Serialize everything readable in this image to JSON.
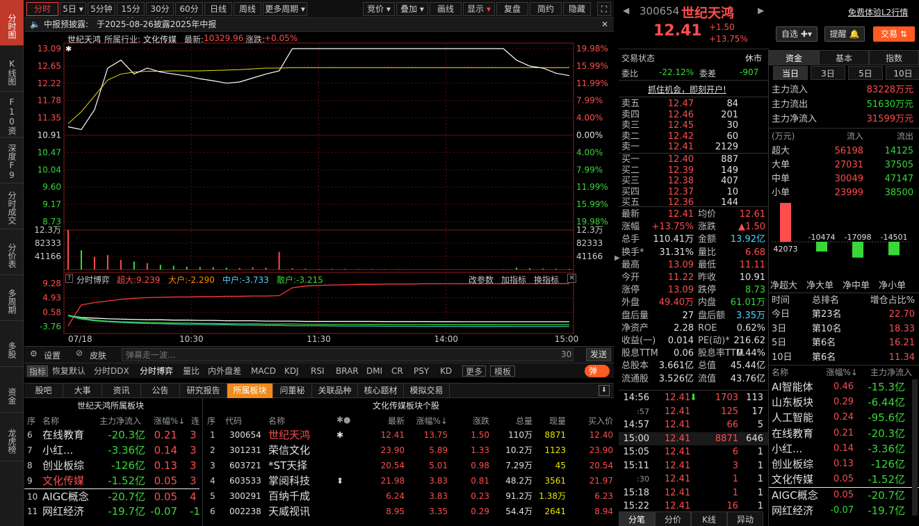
{
  "sidebar": [
    {
      "label": "分时图",
      "active": true
    },
    {
      "label": "K线图"
    },
    {
      "label": "F10资料"
    },
    {
      "label": "深度F9"
    },
    {
      "label": "分时成交"
    },
    {
      "label": "分价表"
    },
    {
      "label": "多周期"
    },
    {
      "label": "多股"
    },
    {
      "label": "资金"
    },
    {
      "label": "龙虎榜"
    }
  ],
  "toolbar": {
    "periods": [
      "分时",
      "5日",
      "5分钟",
      "15分钟",
      "30分钟",
      "60分钟",
      "日线",
      "周线",
      "更多周期"
    ],
    "tools": [
      "竞价",
      "叠加",
      "画线",
      "显示",
      "复盘",
      "简约",
      "隐藏"
    ]
  },
  "notice": {
    "label": "中报预披露:",
    "text": "于2025-08-26披露2025年中报"
  },
  "chart_header": {
    "name": "世纪天鸿",
    "industry_label": "所属行业:",
    "industry": "文化传媒",
    "latest_label": "最新:",
    "latest": "10329.96",
    "change_label": "涨跌:",
    "change": "+0.05%"
  },
  "chart_data": {
    "type": "line",
    "price_axis": [
      "13.09",
      "12.65",
      "12.22",
      "11.78",
      "11.35",
      "10.91",
      "10.47",
      "10.04",
      "9.60",
      "9.17",
      "8.73"
    ],
    "pct_axis": [
      "19.98%",
      "15.99%",
      "11.99%",
      "7.99%",
      "4.00%",
      "0.00%",
      "4.00%",
      "7.99%",
      "11.99%",
      "15.99%",
      "19.98%"
    ],
    "prev_close": 10.91,
    "vol_axis": [
      "12.3万",
      "82333",
      "41166"
    ],
    "vol_axis_right": [
      "12.3万",
      "82333",
      "41166"
    ],
    "time_axis": [
      "07/18",
      "10:30",
      "11:30",
      "14:00",
      "15:00"
    ],
    "price": [
      11.12,
      11.05,
      11.55,
      12.6,
      12.8,
      12.45,
      12.6,
      12.5,
      12.45,
      12.4,
      12.33,
      12.28,
      12.22,
      12.25,
      12.35,
      12.45,
      12.53,
      13.09,
      13.09,
      13.09,
      13.09,
      13.09,
      13.09,
      13.09,
      13.09,
      13.09,
      13.09,
      13.09,
      13.09,
      13.09,
      13.09,
      13.09,
      13.09,
      13.09,
      12.8,
      12.65,
      12.6,
      12.47,
      12.41
    ],
    "avg": [
      11.2,
      11.5,
      11.9,
      12.3,
      12.45,
      12.5,
      12.52,
      12.52,
      12.53,
      12.53,
      12.53,
      12.54,
      12.55,
      12.56,
      12.58,
      12.6,
      12.6,
      12.61,
      12.61,
      12.61,
      12.61,
      12.61,
      12.61,
      12.61,
      12.61,
      12.61,
      12.61,
      12.61,
      12.61,
      12.61,
      12.61,
      12.61,
      12.61,
      12.61,
      12.61,
      12.61,
      12.61,
      12.61,
      12.61
    ],
    "volume": [
      123000,
      60000,
      40000,
      45000,
      30000,
      25000,
      20000,
      15000,
      12000,
      9000,
      8000,
      7000,
      6000,
      5000,
      7000,
      6000,
      55000,
      4000,
      3000,
      2000,
      2500,
      2000,
      1500,
      1500,
      1200,
      1200,
      1000,
      1000,
      1000,
      900,
      900,
      800,
      800,
      1200,
      6000,
      4000,
      3000,
      2500,
      2000
    ],
    "bo_axis": [
      "9.28",
      "4.93",
      "0.58",
      "-3.76"
    ],
    "super_flow": [
      -3.5,
      2.8,
      3.5,
      4.0,
      4.5,
      4.8,
      5.0,
      5.1,
      5.2,
      5.2,
      5.3,
      5.3,
      5.4,
      5.4,
      5.5,
      5.5,
      5.6,
      8.0,
      8.5,
      8.7,
      8.8,
      8.9,
      9.0,
      9.0,
      9.1,
      9.1,
      9.1,
      9.2,
      9.2,
      9.2,
      9.2,
      9.2,
      9.2,
      9.2,
      9.23,
      9.23,
      9.24,
      9.24,
      9.24
    ],
    "big_flow": [
      -0.4,
      -1.0,
      -1.2,
      -1.4,
      -1.5,
      -1.6,
      -1.7,
      -1.7,
      -1.8,
      -1.8,
      -1.9,
      -1.9,
      -2.0,
      -2.0,
      -2.0,
      -2.1,
      -2.1,
      -2.1,
      -2.2,
      -2.2,
      -2.2,
      -2.2,
      -2.2,
      -2.2,
      -2.25,
      -2.25,
      -2.25,
      -2.25,
      -2.27,
      -2.27,
      -2.28,
      -2.28,
      -2.28,
      -2.28,
      -2.29,
      -2.29,
      -2.29,
      -2.29,
      -2.29
    ],
    "mid_flow": [
      -0.5,
      -1.5,
      -2.0,
      -2.3,
      -2.5,
      -2.7,
      -2.8,
      -2.9,
      -3.0,
      -3.1,
      -3.1,
      -3.2,
      -3.2,
      -3.3,
      -3.3,
      -3.4,
      -3.4,
      -3.5,
      -3.5,
      -3.5,
      -3.55,
      -3.6,
      -3.6,
      -3.6,
      -3.65,
      -3.65,
      -3.65,
      -3.7,
      -3.7,
      -3.7,
      -3.7,
      -3.72,
      -3.72,
      -3.72,
      -3.73,
      -3.73,
      -3.73,
      -3.73,
      -3.73
    ],
    "small_flow": [
      -0.3,
      -1.2,
      -1.8,
      -2.1,
      -2.3,
      -2.4,
      -2.5,
      -2.6,
      -2.7,
      -2.7,
      -2.8,
      -2.8,
      -2.9,
      -2.9,
      -2.9,
      -3.0,
      -3.0,
      -3.0,
      -3.05,
      -3.05,
      -3.1,
      -3.1,
      -3.1,
      -3.12,
      -3.12,
      -3.15,
      -3.15,
      -3.16,
      -3.17,
      -3.18,
      -3.19,
      -3.2,
      -3.2,
      -3.21,
      -3.21,
      -3.21,
      -3.215,
      -3.215,
      -3.215
    ]
  },
  "bo": {
    "title": "分时博弈",
    "super": "超大:9.239",
    "big": "大户:-2.290",
    "mid": "中户:-3.733",
    "small": "散户:-3.215",
    "links": [
      "改参数",
      "加指标",
      "换指标"
    ]
  },
  "bottom_bar": {
    "settings": "设置",
    "skin": "皮肤",
    "danmaku_placeholder": "弹幕走一波...",
    "count": "30",
    "send": "发送"
  },
  "indicators": [
    "指标",
    "恢复默认",
    "分时DDX",
    "分时博弈",
    "量比",
    "内外盘差",
    "MACD",
    "KDJ",
    "RSI",
    "BRAR",
    "DMI",
    "CR",
    "PSY",
    "KD",
    "更多",
    "模板",
    "弹"
  ],
  "tabs": [
    "股吧",
    "大事",
    "资讯",
    "公告",
    "研究报告",
    "所属板块",
    "问董秘",
    "关联品种",
    "核心题材",
    "模拟交易"
  ],
  "sector": {
    "title": "世纪天鸿所属板块",
    "headers": [
      "序",
      "名称",
      "主力净流入",
      "涨幅%",
      "连"
    ],
    "rows": [
      {
        "no": "6",
        "name": "在线教育",
        "flow": "-20.3亿",
        "pct": "0.21",
        "x": "3"
      },
      {
        "no": "7",
        "name": "小红...",
        "flow": "-3.36亿",
        "pct": "0.14",
        "x": "3"
      },
      {
        "no": "8",
        "name": "创业板综",
        "flow": "-126亿",
        "pct": "0.13",
        "x": "3"
      },
      {
        "no": "9",
        "name": "文化传媒",
        "flow": "-1.52亿",
        "pct": "0.05",
        "x": "3"
      },
      {
        "no": "10",
        "name": "AIGC概念",
        "flow": "-20.7亿",
        "pct": "0.05",
        "x": "4"
      },
      {
        "no": "11",
        "name": "网红经济",
        "flow": "-19.7亿",
        "pct": "-0.07",
        "x": "-1"
      }
    ]
  },
  "stocks": {
    "title": "文化传媒板块个股",
    "headers": [
      "序",
      "代码",
      "名称",
      "最新",
      "涨幅%",
      "涨跌",
      "总量",
      "现量",
      "买入价"
    ],
    "rows": [
      {
        "no": "1",
        "code": "300654",
        "name": "世纪天鸿",
        "mark": "✱",
        "last": "12.41",
        "pct": "13.75",
        "chg": "1.50",
        "vol": "110万",
        "cur": "8871",
        "bid": "12.40"
      },
      {
        "no": "2",
        "code": "301231",
        "name": "荣信文化",
        "mark": "",
        "last": "23.90",
        "pct": "5.89",
        "chg": "1.33",
        "vol": "10.2万",
        "cur": "1123",
        "bid": "23.90"
      },
      {
        "no": "3",
        "code": "603721",
        "name": "*ST天择",
        "mark": "",
        "last": "20.54",
        "pct": "5.01",
        "chg": "0.98",
        "vol": "7.29万",
        "cur": "45",
        "bid": "20.54"
      },
      {
        "no": "4",
        "code": "603533",
        "name": "掌阅科技",
        "mark": "⬍",
        "last": "21.98",
        "pct": "3.83",
        "chg": "0.81",
        "vol": "48.2万",
        "cur": "3561",
        "bid": "21.97"
      },
      {
        "no": "5",
        "code": "300291",
        "name": "百纳千成",
        "mark": "",
        "last": "6.24",
        "pct": "3.83",
        "chg": "0.23",
        "vol": "91.2万",
        "cur": "1.38万",
        "bid": "6.23"
      },
      {
        "no": "6",
        "code": "002238",
        "name": "天威视讯",
        "mark": "",
        "last": "8.95",
        "pct": "3.35",
        "chg": "0.29",
        "vol": "54.4万",
        "cur": "2641",
        "bid": "8.94"
      }
    ]
  },
  "quote": {
    "code": "300654",
    "name": "世纪天鸿",
    "price": "12.41",
    "chg": "+1.50",
    "pct": "+13.75%",
    "promo": "免费体验L2行情",
    "btn_watch": "自选",
    "btn_alert": "提醒",
    "btn_trade": "交易",
    "status_label": "交易状态",
    "status": "休市",
    "weibi_label": "委比",
    "weibi": "-22.12%",
    "weicha_label": "委差",
    "weicha": "-907",
    "open_account": "抓住机会，即刻开户!"
  },
  "asks": [
    {
      "label": "卖五",
      "price": "12.47",
      "vol": "84"
    },
    {
      "label": "卖四",
      "price": "12.46",
      "vol": "201"
    },
    {
      "label": "卖三",
      "price": "12.45",
      "vol": "30"
    },
    {
      "label": "卖二",
      "price": "12.42",
      "vol": "60"
    },
    {
      "label": "卖一",
      "price": "12.41",
      "vol": "2129"
    }
  ],
  "bids": [
    {
      "label": "买一",
      "price": "12.40",
      "vol": "887"
    },
    {
      "label": "买二",
      "price": "12.39",
      "vol": "149"
    },
    {
      "label": "买三",
      "price": "12.38",
      "vol": "407"
    },
    {
      "label": "买四",
      "price": "12.37",
      "vol": "10"
    },
    {
      "label": "买五",
      "price": "12.36",
      "vol": "144"
    }
  ],
  "stats": [
    {
      "l": "最新",
      "v": "12.41",
      "c": "red",
      "l2": "均价",
      "v2": "12.61",
      "c2": "red"
    },
    {
      "l": "涨幅",
      "v": "+13.75%",
      "c": "red",
      "l2": "涨跌",
      "v2": "▲1.50",
      "c2": "red"
    },
    {
      "l": "总手",
      "v": "110.41万",
      "c": "white",
      "l2": "金额",
      "v2": "13.92亿",
      "c2": "cyan"
    },
    {
      "l": "换手*",
      "v": "31.31%",
      "c": "white",
      "l2": "量比",
      "v2": "6.68",
      "c2": "red"
    },
    {
      "l": "最高",
      "v": "13.09",
      "c": "red",
      "l2": "最低",
      "v2": "11.11",
      "c2": "red"
    },
    {
      "l": "今开",
      "v": "11.22",
      "c": "red",
      "l2": "昨收",
      "v2": "10.91",
      "c2": "white"
    },
    {
      "l": "涨停",
      "v": "13.09",
      "c": "red",
      "l2": "跌停",
      "v2": "8.73",
      "c2": "green"
    },
    {
      "l": "外盘",
      "v": "49.40万",
      "c": "red",
      "l2": "内盘",
      "v2": "61.01万",
      "c2": "green"
    },
    {
      "l": "盘后量",
      "v": "27",
      "c": "white",
      "l2": "盘后额",
      "v2": "3.35万",
      "c2": "cyan"
    },
    {
      "l": "净资产",
      "v": "2.28",
      "c": "white",
      "l2": "ROE",
      "v2": "0.62%",
      "c2": "white"
    },
    {
      "l": "收益(一)",
      "v": "0.014",
      "c": "white",
      "l2": "PE(动)*",
      "v2": "216.62",
      "c2": "white"
    },
    {
      "l": "股息TTM",
      "v": "0.06",
      "c": "white",
      "l2": "股息率TTM",
      "v2": "0.44%",
      "c2": "white"
    },
    {
      "l": "总股本",
      "v": "3.661亿",
      "c": "white",
      "l2": "总值",
      "v2": "45.44亿",
      "c2": "white"
    },
    {
      "l": "流通股",
      "v": "3.526亿",
      "c": "white",
      "l2": "流值",
      "v2": "43.76亿",
      "c2": "white"
    }
  ],
  "ticks": [
    {
      "t": "14:56",
      "p": "12.41",
      "arrow": "⬇",
      "v": "1703",
      "n": "113"
    },
    {
      "t": ":57",
      "p": "12.41",
      "arrow": "",
      "v": "125",
      "n": "17"
    },
    {
      "t": "14:57",
      "p": "12.41",
      "arrow": "",
      "v": "66",
      "n": "5"
    },
    {
      "t": "15:00",
      "p": "12.41",
      "arrow": "",
      "v": "8871",
      "n": "646"
    },
    {
      "t": "15:05",
      "p": "12.41",
      "arrow": "",
      "v": "6",
      "n": "1"
    },
    {
      "t": "15:11",
      "p": "12.41",
      "arrow": "",
      "v": "3",
      "n": "1"
    },
    {
      "t": ":30",
      "p": "12.41",
      "arrow": "",
      "v": "1",
      "n": "1"
    },
    {
      "t": "15:18",
      "p": "12.41",
      "arrow": "",
      "v": "1",
      "n": "1"
    },
    {
      "t": "15:22",
      "p": "12.41",
      "arrow": "",
      "v": "16",
      "n": "1"
    }
  ],
  "tick_tabs": [
    "分笔",
    "分价",
    "K线",
    "异动"
  ],
  "fund_tabs": [
    "资金",
    "基本",
    "指数"
  ],
  "day_tabs": [
    "当日",
    "3日",
    "5日",
    "10日"
  ],
  "main_flow": [
    {
      "l": "主力流入",
      "v": "83228万元",
      "c": "red"
    },
    {
      "l": "主力流出",
      "v": "51630万元",
      "c": "green"
    },
    {
      "l": "主力净流入",
      "v": "31599万元",
      "c": "red"
    }
  ],
  "flow_table": {
    "headers": [
      "(万元)",
      "流入",
      "流出"
    ],
    "rows": [
      {
        "l": "超大",
        "in": "56198",
        "out": "14125"
      },
      {
        "l": "大单",
        "in": "27031",
        "out": "37505"
      },
      {
        "l": "中单",
        "in": "30049",
        "out": "47147"
      },
      {
        "l": "小单",
        "in": "23999",
        "out": "38500"
      }
    ]
  },
  "net_bars": {
    "labels": [
      "净超大",
      "净大单",
      "净中单",
      "净小单"
    ],
    "values": [
      42073,
      -10474,
      -17098,
      -14501
    ],
    "value_labels": [
      "42073",
      "-10474",
      "-17098",
      "-14501"
    ]
  },
  "rank": {
    "headers": [
      "时间",
      "总排名",
      "增仓占比%"
    ],
    "rows": [
      {
        "t": "今日",
        "r": "第23名",
        "v": "22.70"
      },
      {
        "t": "3日",
        "r": "第10名",
        "v": "18.33"
      },
      {
        "t": "5日",
        "r": "第6名",
        "v": "16.21"
      },
      {
        "t": "10日",
        "r": "第6名",
        "v": "11.34"
      }
    ]
  },
  "concepts": {
    "headers": [
      "名称",
      "涨幅%",
      "主力净流入"
    ],
    "rows": [
      {
        "n": "AI智能体",
        "p": "0.46",
        "f": "-15.3亿"
      },
      {
        "n": "山东板块",
        "p": "0.29",
        "f": "-6.44亿"
      },
      {
        "n": "人工智能",
        "p": "0.24",
        "f": "-95.6亿"
      },
      {
        "n": "在线教育",
        "p": "0.21",
        "f": "-20.3亿"
      },
      {
        "n": "小红...",
        "p": "0.14",
        "f": "-3.36亿"
      },
      {
        "n": "创业板综",
        "p": "0.13",
        "f": "-126亿"
      },
      {
        "n": "文化传媒",
        "p": "0.05",
        "f": "-1.52亿"
      },
      {
        "n": "AIGC概念",
        "p": "0.05",
        "f": "-20.7亿"
      },
      {
        "n": "网红经济",
        "p": "-0.07",
        "f": "-19.7亿"
      }
    ]
  }
}
